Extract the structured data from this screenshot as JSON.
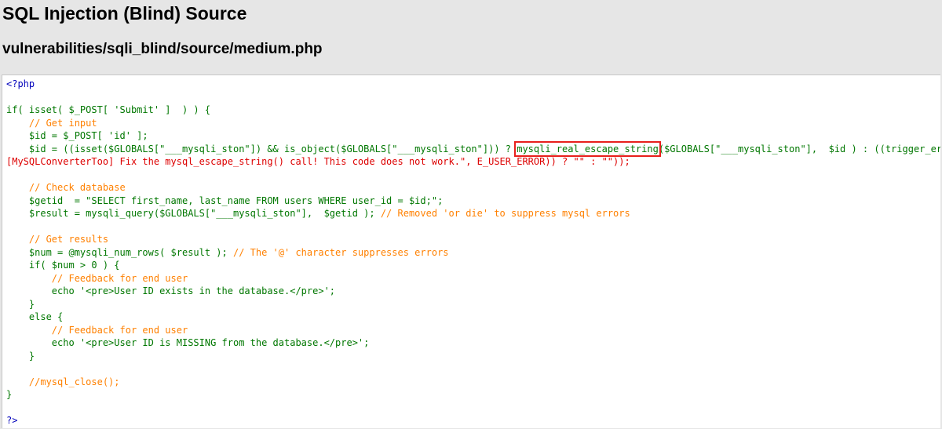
{
  "page": {
    "title": "SQL Injection (Blind) Source",
    "file_path": "vulnerabilities/sqli_blind/source/medium.php"
  },
  "colors": {
    "keyword": "#007700",
    "tag": "#0000bb",
    "comment": "#ff8000",
    "string": "#dd0000",
    "highlight_box": "#e8201c"
  },
  "code": {
    "open_tag": "<?php",
    "l3": "if( isset( $_POST[ 'Submit' ]  ) ) {",
    "l4": "    // Get input",
    "l5": "    $id = $_POST[ 'id' ];",
    "l6_a": "    $id = ((isset($GLOBALS[\"___mysqli_ston\"]) && is_object($GLOBALS[\"___mysqli_ston\"])) ? ",
    "l6_highlight": "mysqli_real_escape_string",
    "l6_b": "($GLOBALS[\"___mysqli_ston\"],  $id ) : ((trigger_error(\"",
    "l7": "[MySQLConverterToo] Fix the mysql_escape_string() call! This code does not work.\", E_USER_ERROR)) ? \"\" : \"\"));",
    "l9": "    // Check database",
    "l10": "    $getid  = \"SELECT first_name, last_name FROM users WHERE user_id = $id;\";",
    "l11_code": "    $result = mysqli_query($GLOBALS[\"___mysqli_ston\"],  $getid ); ",
    "l11_comment": "// Removed 'or die' to suppress mysql errors",
    "l13": "    // Get results",
    "l14_code": "    $num = @mysqli_num_rows( $result ); ",
    "l14_comment": "// The '@' character suppresses errors",
    "l15": "    if( $num > 0 ) {",
    "l16": "        // Feedback for end user",
    "l17": "        echo '<pre>User ID exists in the database.</pre>';",
    "l18": "    }",
    "l19": "    else {",
    "l20": "        // Feedback for end user",
    "l21": "        echo '<pre>User ID is MISSING from the database.</pre>';",
    "l22": "    }",
    "l24": "    //mysql_close();",
    "l25": "}",
    "close_tag": "?>"
  }
}
